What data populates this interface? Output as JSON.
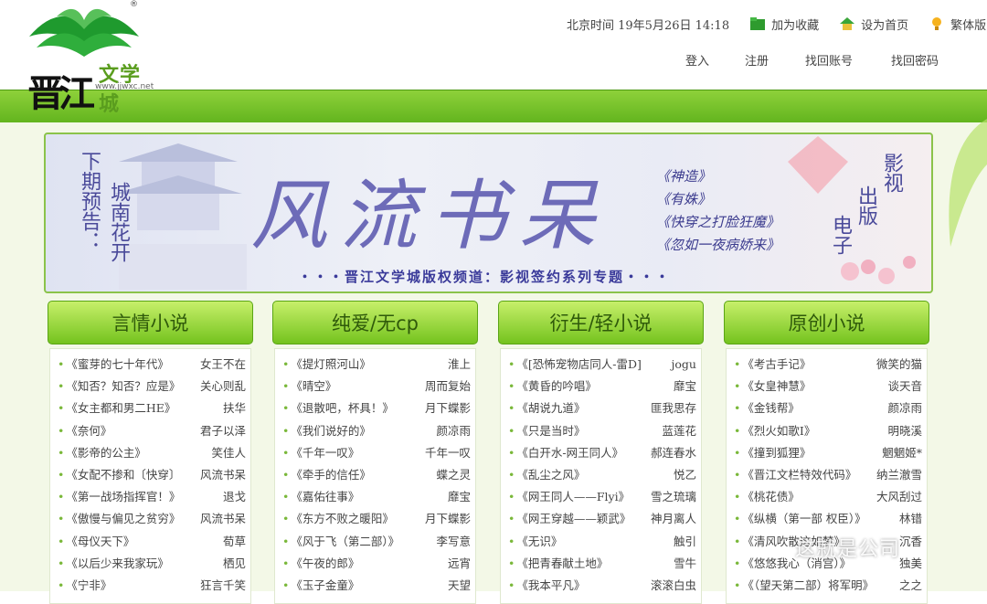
{
  "logo": {
    "cn_text": "晋江",
    "en_text": "文学城",
    "url": "www.jjwxc.net",
    "reg": "®"
  },
  "topbar": {
    "time_label": "北京时间  19年5月26日  14:18",
    "links": [
      {
        "label": "加为收藏",
        "icon": "folder-icon"
      },
      {
        "label": "设为首页",
        "icon": "home-icon"
      },
      {
        "label": "繁体版",
        "icon": "bulb-icon"
      }
    ]
  },
  "account": {
    "login": "登入",
    "register": "注册",
    "recover_account": "找回账号",
    "recover_password": "找回密码"
  },
  "banner": {
    "left_text": [
      "下期预告：",
      "城南花开"
    ],
    "big_title": "风流书呆",
    "books": [
      "《神造》",
      "《有姝》",
      "《快穿之打脸狂魔》",
      "《忽如一夜病娇来》"
    ],
    "right_text": [
      "影视",
      "出版",
      "电子"
    ],
    "footer": "・・・晋江文学城版权频道：影视签约系列专题・・・"
  },
  "columns": [
    {
      "title": "言情小说",
      "items": [
        {
          "title": "《蜜芽的七十年代》",
          "author": "女王不在"
        },
        {
          "title": "《知否？知否？应是》",
          "author": "关心则乱"
        },
        {
          "title": "《女主都和男二HE》",
          "author": "扶华"
        },
        {
          "title": "《奈何》",
          "author": "君子以泽"
        },
        {
          "title": "《影帝的公主》",
          "author": "笑佳人"
        },
        {
          "title": "《女配不掺和〔快穿〕",
          "author": "风流书呆"
        },
        {
          "title": "《第一战场指挥官！》",
          "author": "退戈"
        },
        {
          "title": "《傲慢与偏见之贫穷》",
          "author": "风流书呆"
        },
        {
          "title": "《母仪天下》",
          "author": "荀草"
        },
        {
          "title": "《以后少来我家玩》",
          "author": "栖见"
        },
        {
          "title": "《宁非》",
          "author": "狂言千笑"
        }
      ]
    },
    {
      "title": "纯爱/无cp",
      "items": [
        {
          "title": "《提灯照河山》",
          "author": "淮上"
        },
        {
          "title": "《晴空》",
          "author": "周而复始"
        },
        {
          "title": "《退散吧，杯具！》",
          "author": "月下蝶影"
        },
        {
          "title": "《我们说好的》",
          "author": "颜凉雨"
        },
        {
          "title": "《千年一叹》",
          "author": "千年一叹"
        },
        {
          "title": "《牵手的信任》",
          "author": "蝶之灵"
        },
        {
          "title": "《嘉佑往事》",
          "author": "靡宝"
        },
        {
          "title": "《东方不败之暖阳》",
          "author": "月下蝶影"
        },
        {
          "title": "《风于飞（第二部）》",
          "author": "李写意"
        },
        {
          "title": "《午夜的郎》",
          "author": "远宵"
        },
        {
          "title": "《玉子金童》",
          "author": "天望"
        }
      ]
    },
    {
      "title": "衍生/轻小说",
      "items": [
        {
          "title": "《[恐怖宠物店同人-雷D]",
          "author": "jogu"
        },
        {
          "title": "《黄昏的吟唱》",
          "author": "靡宝"
        },
        {
          "title": "《胡说九道》",
          "author": "匪我思存"
        },
        {
          "title": "《只是当时》",
          "author": "蓝莲花"
        },
        {
          "title": "《白开水-网王同人》",
          "author": "郝连春水"
        },
        {
          "title": "《乱尘之风》",
          "author": "悦乙"
        },
        {
          "title": "《网王同人——Flyi》",
          "author": "雪之琉璃"
        },
        {
          "title": "《网王穿越——颖武》",
          "author": "神月离人"
        },
        {
          "title": "《无识》",
          "author": "触引"
        },
        {
          "title": "《把青春献土地》",
          "author": "雪牛"
        },
        {
          "title": "《我本平凡》",
          "author": "滚滚白虫"
        }
      ]
    },
    {
      "title": "原创小说",
      "items": [
        {
          "title": "《考古手记》",
          "author": "微笑的猫"
        },
        {
          "title": "《女皇神慧》",
          "author": "谈天音"
        },
        {
          "title": "《金钱帮》",
          "author": "颜凉雨"
        },
        {
          "title": "《烈火如歌I》",
          "author": "明晓溪"
        },
        {
          "title": "《撞到狐狸》",
          "author": "魍魍姬*"
        },
        {
          "title": "《晋江文栏特效代码》",
          "author": "纳兰澈雪"
        },
        {
          "title": "《桃花债》",
          "author": "大风刮过"
        },
        {
          "title": "《纵横（第一部 权臣）》",
          "author": "林错"
        },
        {
          "title": "《清风吹散这如梦》",
          "author": "沉香"
        },
        {
          "title": "《悠悠我心（消宫）》",
          "author": "独美"
        },
        {
          "title": "《（望天第二部）将军明》",
          "author": "之之"
        }
      ]
    }
  ],
  "watermark": "这就是公司",
  "colors": {
    "accent_green": "#6cbd20",
    "banner_purple": "#6d6bb8"
  }
}
